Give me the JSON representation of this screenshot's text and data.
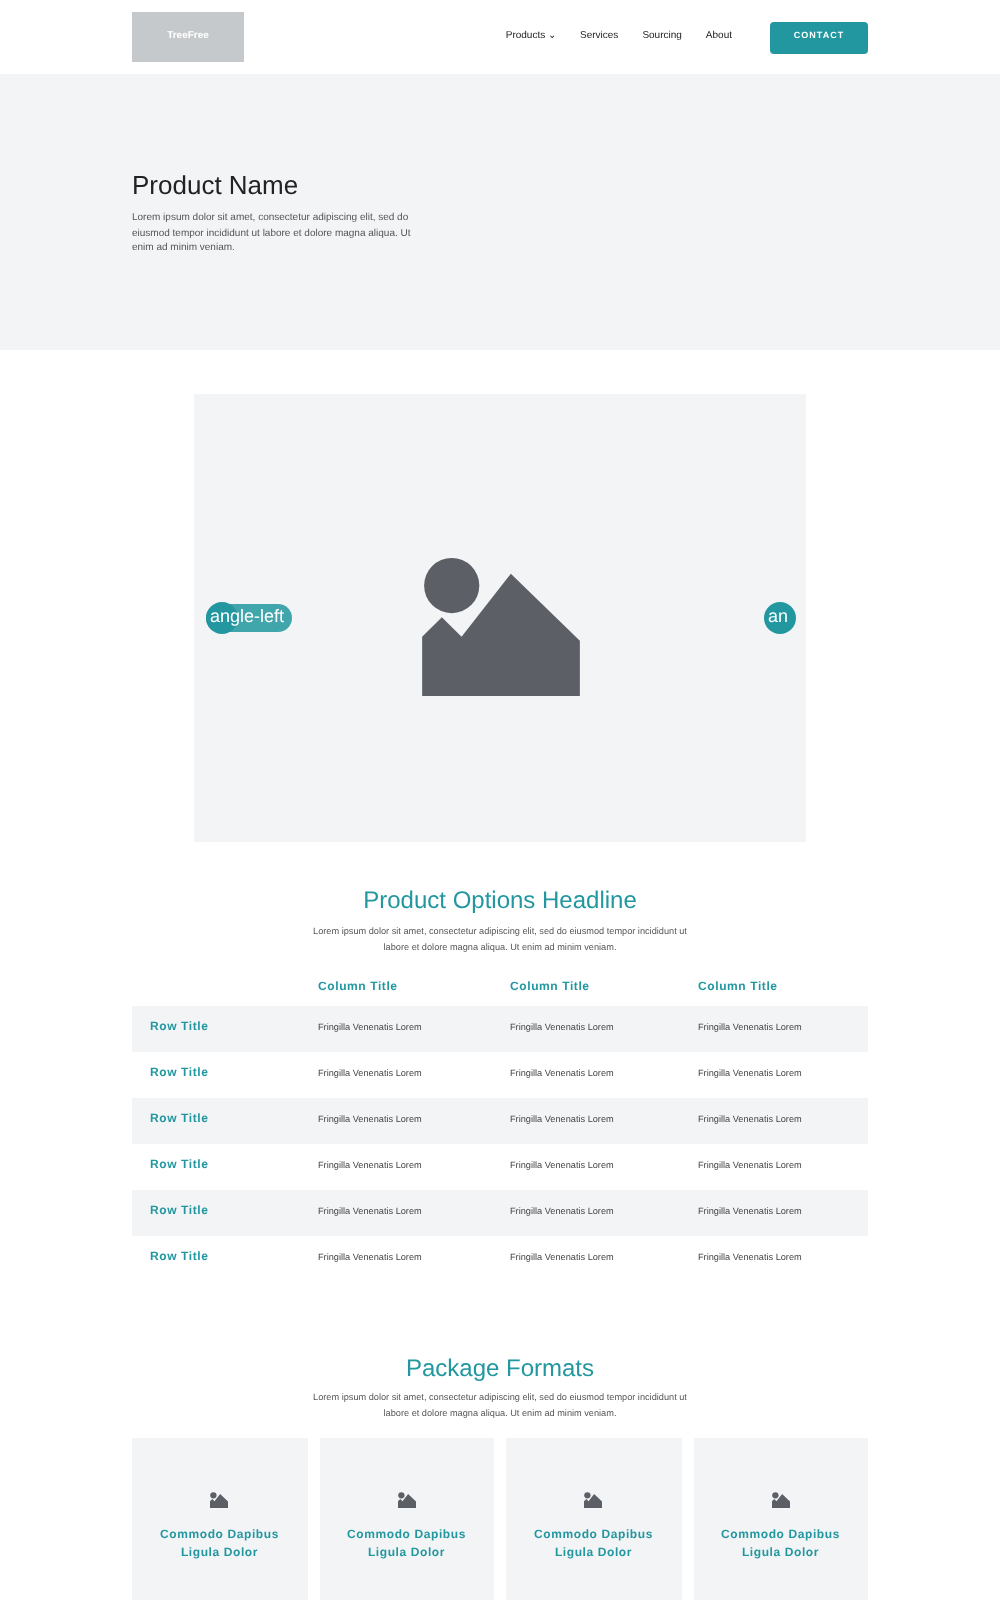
{
  "header": {
    "logo": "TreeFree",
    "nav": [
      {
        "label": "Products",
        "dropdown": true
      },
      {
        "label": "Services",
        "dropdown": false
      },
      {
        "label": "Sourcing",
        "dropdown": false
      },
      {
        "label": "About",
        "dropdown": false
      }
    ],
    "dropdown_mark": "⌄",
    "cta": "CONTACT"
  },
  "hero": {
    "title": "Product Name",
    "text": "Lorem ipsum dolor sit amet, consectetur adipiscing elit, sed do eiusmod tempor incididunt ut labore et dolore magna aliqua. Ut enim ad minim veniam."
  },
  "carousel": {
    "prev_label": "angle-left",
    "next_label": "an"
  },
  "options": {
    "title": "Product Options Headline",
    "text": "Lorem ipsum dolor sit amet, consectetur adipiscing elit, sed do eiusmod tempor incididunt ut labore et dolore magna aliqua. Ut enim ad minim veniam.",
    "columns": [
      "Column Title",
      "Column Title",
      "Column Title"
    ],
    "rows": [
      {
        "title": "Row Title",
        "cells": [
          "Fringilla Venenatis Lorem",
          "Fringilla Venenatis Lorem",
          "Fringilla Venenatis Lorem"
        ]
      },
      {
        "title": "Row Title",
        "cells": [
          "Fringilla Venenatis Lorem",
          "Fringilla Venenatis Lorem",
          "Fringilla Venenatis Lorem"
        ]
      },
      {
        "title": "Row Title",
        "cells": [
          "Fringilla Venenatis Lorem",
          "Fringilla Venenatis Lorem",
          "Fringilla Venenatis Lorem"
        ]
      },
      {
        "title": "Row Title",
        "cells": [
          "Fringilla Venenatis Lorem",
          "Fringilla Venenatis Lorem",
          "Fringilla Venenatis Lorem"
        ]
      },
      {
        "title": "Row Title",
        "cells": [
          "Fringilla Venenatis Lorem",
          "Fringilla Venenatis Lorem",
          "Fringilla Venenatis Lorem"
        ]
      },
      {
        "title": "Row Title",
        "cells": [
          "Fringilla Venenatis Lorem",
          "Fringilla Venenatis Lorem",
          "Fringilla Venenatis Lorem"
        ]
      }
    ]
  },
  "packages": {
    "title": "Package Formats",
    "text": "Lorem ipsum dolor sit amet, consectetur adipiscing elit, sed do eiusmod tempor incididunt ut labore et dolore magna aliqua. Ut enim ad minim veniam.",
    "cards": [
      {
        "title": "Commodo Dapibus Ligula Dolor"
      },
      {
        "title": "Commodo Dapibus Ligula Dolor"
      },
      {
        "title": "Commodo Dapibus Ligula Dolor"
      },
      {
        "title": "Commodo Dapibus Ligula Dolor"
      }
    ]
  }
}
